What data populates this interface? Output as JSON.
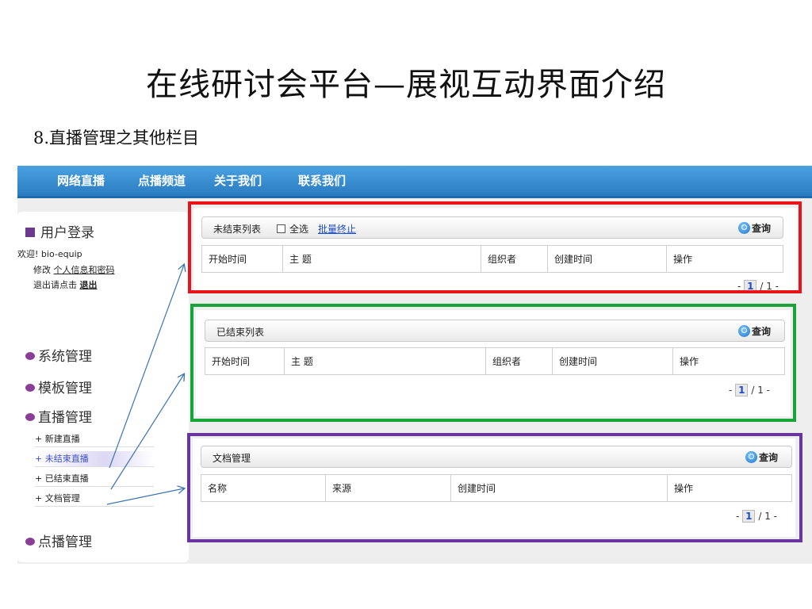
{
  "slide": {
    "title": "在线研讨会平台—展视互动界面介绍",
    "subtitle": "8.直播管理之其他栏目"
  },
  "nav": {
    "items": [
      "网络直播",
      "点播频道",
      "关于我们",
      "联系我们"
    ],
    "color": "#2f86cf"
  },
  "sidebar": {
    "login": {
      "title": "用户登录",
      "welcome": "欢迎! bio-equip",
      "modify_prefix": "修改",
      "modify_link": "个人信息和密码",
      "logout_prefix": "退出请点击",
      "logout_link": "退出"
    },
    "sections": [
      "系统管理",
      "模板管理",
      "直播管理"
    ],
    "live_items": [
      "+ 新建直播",
      "+ 未结束直播",
      "+ 已结束直播",
      "+ 文档管理"
    ],
    "active_item": "+ 未结束直播",
    "last_section": "点播管理"
  },
  "panels": {
    "unfinished": {
      "title": "未结束列表",
      "select_all": "全选",
      "batch_stop": "批量终止",
      "query": "查询",
      "columns": [
        "开始时间",
        "主 题",
        "组织者",
        "创建时间",
        "操作"
      ],
      "pager": {
        "prefix": "-",
        "page": "1",
        "suffix": "/ 1 -"
      },
      "frame_color": "#e8141b"
    },
    "finished": {
      "title": "已结束列表",
      "query": "查询",
      "columns": [
        "开始时间",
        "主 题",
        "组织者",
        "创建时间",
        "操作"
      ],
      "pager": {
        "prefix": "-",
        "page": "1",
        "suffix": "/ 1 -"
      },
      "frame_color": "#17a53a"
    },
    "documents": {
      "title": "文档管理",
      "query": "查询",
      "columns": [
        "名称",
        "来源",
        "创建时间",
        "操作"
      ],
      "pager": {
        "prefix": "-",
        "page": "1",
        "suffix": "/ 1 -"
      },
      "frame_color": "#6a35a0"
    }
  }
}
